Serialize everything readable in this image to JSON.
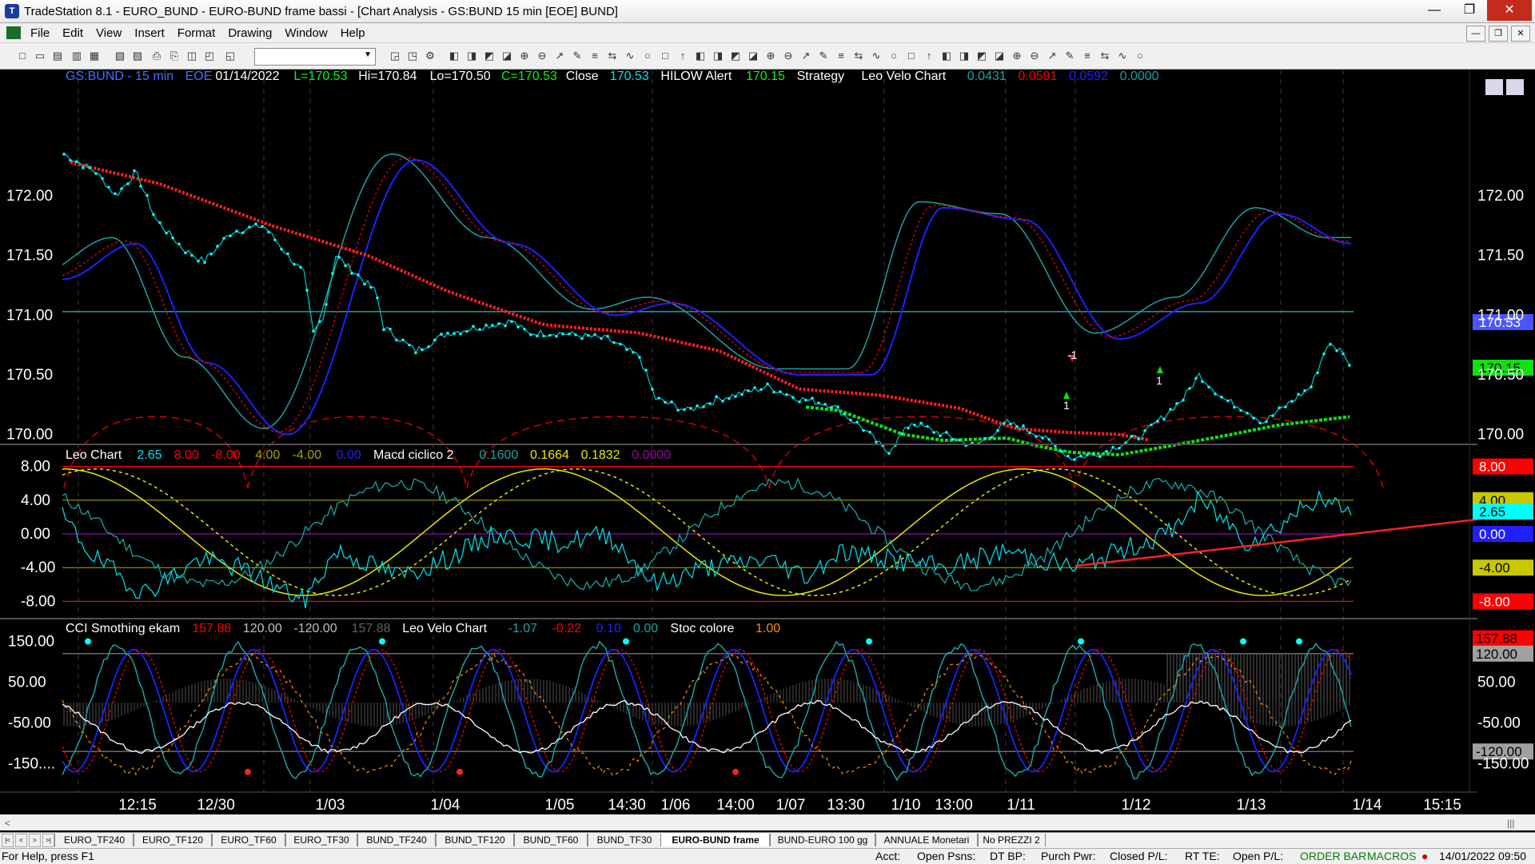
{
  "window": {
    "title": "TradeStation 8.1 - EURO_BUND - EURO-BUND frame bassi - [Chart Analysis - GS:BUND  15 min  [EOE] BUND]"
  },
  "menu": [
    "File",
    "Edit",
    "View",
    "Insert",
    "Format",
    "Drawing",
    "Window",
    "Help"
  ],
  "colors": {
    "bg": "#000000",
    "cyan": "#00e5ee",
    "teal": "#1aa3a3",
    "red": "#ff0000",
    "green": "#00ff00",
    "blue": "#2020ff",
    "yellow": "#e8e800",
    "orange": "#ff8c00",
    "grey": "#808080"
  },
  "panel1": {
    "legend": [
      {
        "t": "GS:BUND - 15 min",
        "c": "#4a6cff"
      },
      {
        "t": "EOE",
        "c": "#4a6cff"
      },
      {
        "t": "01/14/2022",
        "c": "#ffffff"
      },
      {
        "t": "L=170.53",
        "c": "#00ff00"
      },
      {
        "t": "Hi=170.84",
        "c": "#ffffff"
      },
      {
        "t": "Lo=170.50",
        "c": "#ffffff"
      },
      {
        "t": "C=170.53",
        "c": "#00ff00"
      },
      {
        "t": "Close",
        "c": "#ffffff"
      },
      {
        "t": "170.53",
        "c": "#00e5ee"
      },
      {
        "t": "HILOW Alert",
        "c": "#ffffff"
      },
      {
        "t": "170.15",
        "c": "#00ff00"
      },
      {
        "t": "Strategy",
        "c": "#ffffff"
      },
      {
        "t": "Leo Velo Chart",
        "c": "#ffffff"
      },
      {
        "t": "0.0431",
        "c": "#1aa3a3"
      },
      {
        "t": "0.0591",
        "c": "#ff0000"
      },
      {
        "t": "0.0592",
        "c": "#2020ff"
      },
      {
        "t": "0.0000",
        "c": "#1aa3a3"
      }
    ],
    "y_labels": [
      "172.00",
      "171.50",
      "171.00",
      "170.50",
      "170.00"
    ],
    "price_tag": "170.53",
    "alert_tag": "170.15",
    "marker_labels": [
      "-1",
      "1",
      "1"
    ]
  },
  "panel2": {
    "legend": [
      {
        "t": "Leo Chart",
        "c": "#ffffff"
      },
      {
        "t": "2.65",
        "c": "#00e5ee"
      },
      {
        "t": "8.00",
        "c": "#ff0000"
      },
      {
        "t": "-8.00",
        "c": "#ff0000"
      },
      {
        "t": "4.00",
        "c": "#a0a000"
      },
      {
        "t": "-4.00",
        "c": "#a0a000"
      },
      {
        "t": "0.00",
        "c": "#2020ff"
      },
      {
        "t": "Macd ciclico 2",
        "c": "#ffffff"
      },
      {
        "t": "0.1600",
        "c": "#1aa3a3"
      },
      {
        "t": "0.1664",
        "c": "#e8e800"
      },
      {
        "t": "0.1832",
        "c": "#e8e800"
      },
      {
        "t": "0.0000",
        "c": "#a000a0"
      }
    ],
    "y_labels": [
      "8.00",
      "4.00",
      "0.00",
      "-4.00",
      "-8.00"
    ],
    "tags": [
      {
        "t": "8.00",
        "bg": "#ff0000",
        "fg": "#ffffff"
      },
      {
        "t": "4.00",
        "bg": "#c8c800",
        "fg": "#000000"
      },
      {
        "t": "2.65",
        "bg": "#00ffff",
        "fg": "#000000"
      },
      {
        "t": "0.00",
        "bg": "#2020ff",
        "fg": "#ffffff"
      },
      {
        "t": "-4.00",
        "bg": "#c8c800",
        "fg": "#000000"
      },
      {
        "t": "-8.00",
        "bg": "#ff0000",
        "fg": "#ffffff"
      }
    ]
  },
  "panel3": {
    "legend": [
      {
        "t": "CCI Smothing ekam",
        "c": "#ffffff"
      },
      {
        "t": "157.88",
        "c": "#ff0000"
      },
      {
        "t": "120.00",
        "c": "#c0c0c0"
      },
      {
        "t": "-120.00",
        "c": "#c0c0c0"
      },
      {
        "t": "157.88",
        "c": "#606060"
      },
      {
        "t": "Leo Velo Chart",
        "c": "#ffffff"
      },
      {
        "t": "-1.07",
        "c": "#1aa3a3"
      },
      {
        "t": "-0.22",
        "c": "#ff0000"
      },
      {
        "t": "0.10",
        "c": "#2020ff"
      },
      {
        "t": "0.00",
        "c": "#1aa3a3"
      },
      {
        "t": "Stoc colore",
        "c": "#ffffff"
      },
      {
        "t": "1.00",
        "c": "#ff8c00"
      }
    ],
    "y_labels": [
      "150.00",
      "50.00",
      "-50.00",
      "-150...."
    ],
    "y_labels_right": [
      "50.00",
      "-50.00",
      "-150.00"
    ],
    "tags": [
      {
        "t": "157.88",
        "bg": "#ff0000",
        "fg": "#000000"
      },
      {
        "t": "120.00",
        "bg": "#a0a0a0",
        "fg": "#000000"
      },
      {
        "t": "-120.00",
        "bg": "#a0a0a0",
        "fg": "#000000"
      }
    ]
  },
  "x_axis": [
    "12:15",
    "12/30",
    "1/03",
    "1/04",
    "1/05",
    "14:30",
    "1/06",
    "14:00",
    "1/07",
    "13:30",
    "1/10",
    "13:00",
    "1/11",
    "1/12",
    "1/13",
    "1/14",
    "15:15"
  ],
  "tabs": [
    "EURO_TF240",
    "EURO_TF120",
    "EURO_TF60",
    "EURO_TF30",
    "BUND_TF240",
    "BUND_TF120",
    "BUND_TF60",
    "BUND_TF30",
    "EURO-BUND frame bassi",
    "BUND-EURO 100 gg",
    "ANNUALE Monetari",
    "No PREZZI 2"
  ],
  "active_tab": "EURO-BUND frame bassi",
  "status": {
    "help": "For Help, press F1",
    "acct": "Acct:",
    "open_psns": "Open Psns:",
    "dt_bp": "DT BP:",
    "purch_pwr": "Purch Pwr:",
    "closed_pl": "Closed P/L:",
    "rt_te": "RT TE:",
    "open_pl": "Open P/L:",
    "order_bar": "ORDER BAR",
    "macros": "MACROS",
    "datetime": "14/01/2022 09:50"
  }
}
